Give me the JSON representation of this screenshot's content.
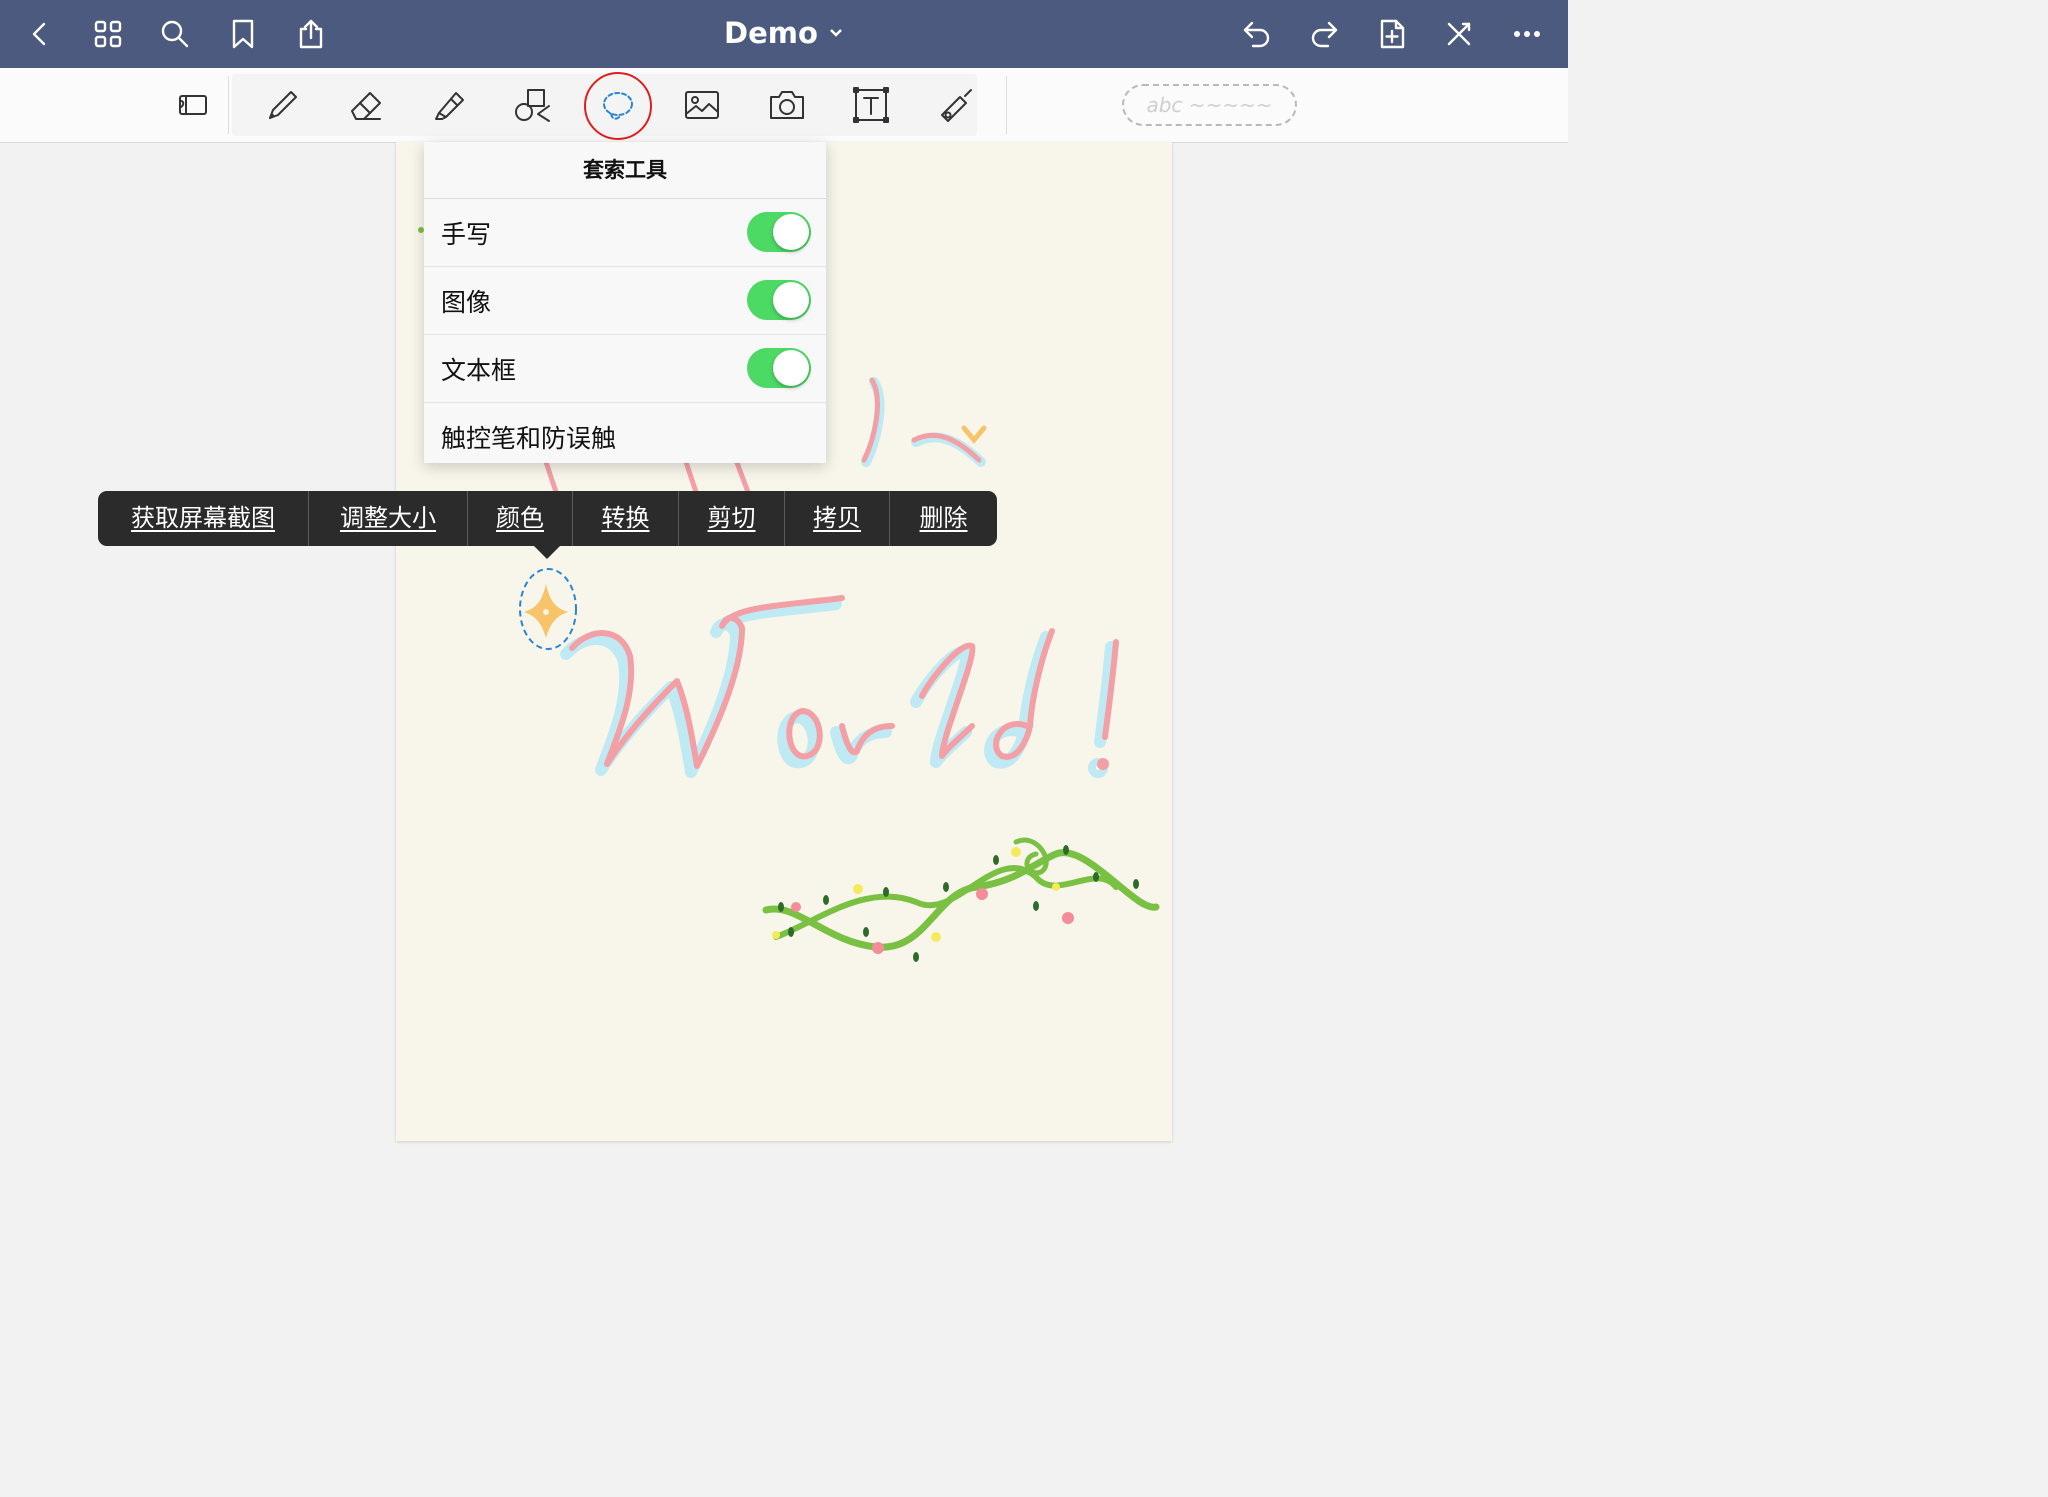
{
  "navbar": {
    "title": "Demo",
    "icons": [
      "back-icon",
      "grid-icon",
      "search-icon",
      "bookmark-icon",
      "share-icon",
      "undo-icon",
      "redo-icon",
      "add-page-icon",
      "close-icon",
      "more-icon"
    ]
  },
  "toolbar": {
    "tools": [
      "page-layout",
      "pen",
      "eraser",
      "highlighter",
      "shapes",
      "lasso",
      "image",
      "camera",
      "text-box",
      "laser-pointer"
    ],
    "selected_tool": "lasso",
    "handwriting_placeholder": "abc ~~~~~"
  },
  "lasso_popover": {
    "title": "套索工具",
    "rows": [
      {
        "label": "手写",
        "enabled": true
      },
      {
        "label": "图像",
        "enabled": true
      },
      {
        "label": "文本框",
        "enabled": true
      },
      {
        "label": "触控笔和防误触"
      }
    ]
  },
  "context_menu": {
    "items": [
      "获取屏幕截图",
      "调整大小",
      "颜色",
      "转换",
      "剪切",
      "拷贝",
      "删除"
    ]
  },
  "canvas": {
    "handwritten_text": "World!",
    "accent_colors": {
      "pink": "#f2a0a6",
      "cyan": "#bfeaf4",
      "vine": "#7ac143",
      "star": "#f7c46c",
      "selection": "#2a85d8"
    }
  }
}
